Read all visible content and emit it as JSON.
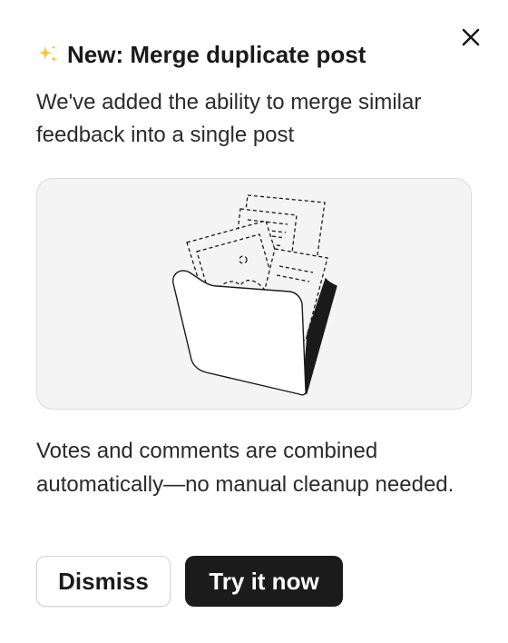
{
  "dialog": {
    "title": "New: Merge duplicate post",
    "title_icon": "sparkles-icon",
    "close_icon": "close-icon",
    "intro": "We've added the ability to merge similar feedback into a single post",
    "illustration": "folder-documents-illustration",
    "details": "Votes and comments are combined automatically—no manual cleanup needed.",
    "dismiss_label": "Dismiss",
    "primary_label": "Try it now"
  },
  "colors": {
    "primary_button": "#1b1b1b",
    "illustration_bg": "#f4f4f4",
    "sparkle": "#f2c94c"
  }
}
